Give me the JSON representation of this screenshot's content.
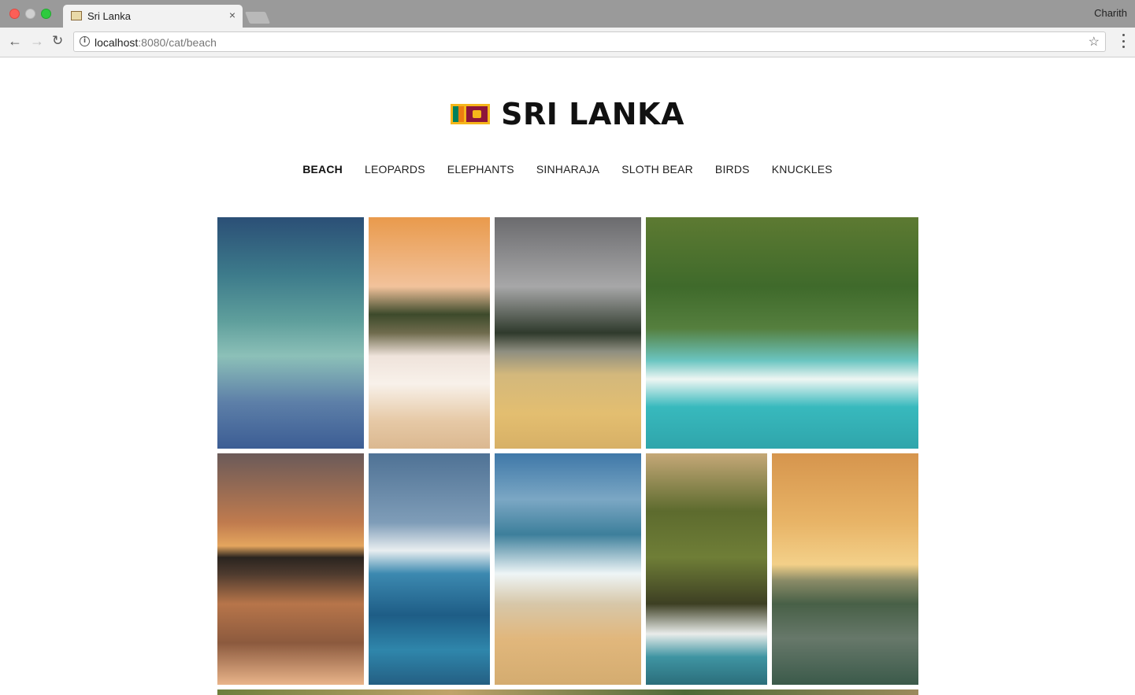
{
  "window": {
    "tab_title": "Sri Lanka",
    "tab_close": "×",
    "profile_name": "Charith",
    "url_host": "localhost",
    "url_rest": ":8080/cat/beach",
    "icons": {
      "favicon": "sri-lanka-flag-icon",
      "back": "arrow-left-icon",
      "forward": "arrow-right-icon",
      "reload": "reload-icon",
      "info": "info-icon",
      "bookmark": "star-icon",
      "menu": "vertical-dots-icon"
    }
  },
  "header": {
    "title": "SRI LANKA",
    "logo_icon": "sri-lanka-flag-icon"
  },
  "nav": {
    "items": [
      {
        "label": "BEACH",
        "active": true
      },
      {
        "label": "LEOPARDS",
        "active": false
      },
      {
        "label": "ELEPHANTS",
        "active": false
      },
      {
        "label": "SINHARAJA",
        "active": false
      },
      {
        "label": "SLOTH BEAR",
        "active": false
      },
      {
        "label": "BIRDS",
        "active": false
      },
      {
        "label": "KNUCKLES",
        "active": false
      }
    ]
  },
  "gallery": {
    "photos": [
      "surfer-wave-photo",
      "palm-beach-people-photo",
      "woman-surfboard-photo",
      "jungle-surfer-photo",
      "sunset-palms-photo",
      "fisherman-boat-photo",
      "dogs-beach-stilts-photo",
      "palm-surfer-photo",
      "golden-sea-photo",
      "palm-row-photo"
    ]
  },
  "colors": {
    "active_nav": "#111111",
    "nav": "#222222",
    "background": "#ffffff"
  }
}
